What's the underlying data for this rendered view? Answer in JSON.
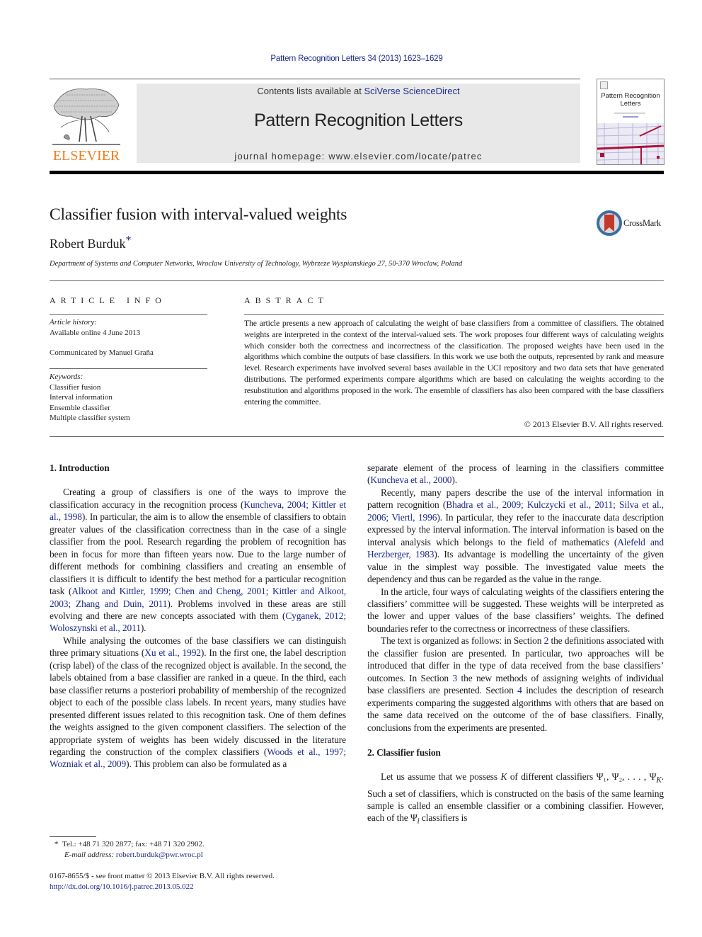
{
  "header": {
    "citation": "Pattern Recognition Letters 34 (2013) 1623–1629",
    "contents_prefix": "Contents lists available at ",
    "contents_link": "SciVerse ScienceDirect",
    "journal_title": "Pattern Recognition Letters",
    "homepage": "journal homepage: www.elsevier.com/locate/patrec",
    "publisher_logo_text": "ELSEVIER",
    "cover_title_line1": "Pattern Recognition",
    "cover_title_line2": "Letters",
    "colors": {
      "link": "#1b2a8a",
      "elsevier_orange": "#f07e1b",
      "banner_gray": "#e8e8e8",
      "crossmark_red": "#c0392b"
    }
  },
  "article": {
    "title": "Classifier fusion with interval-valued weights",
    "author": "Robert Burduk",
    "author_mark": "*",
    "affiliation": "Department of Systems and Computer Networks, Wroclaw University of Technology, Wybrzeze Wyspianskiego 27, 50-370 Wroclaw, Poland",
    "crossmark_label": "CrossMark"
  },
  "article_info": {
    "heading": "ARTICLE INFO",
    "history_label": "Article history:",
    "history_value": "Available online 4 June 2013",
    "communicated": "Communicated by Manuel Graña",
    "keywords_label": "Keywords:",
    "keywords": [
      "Classifier fusion",
      "Interval information",
      "Ensemble classifier",
      "Multiple classifier system"
    ]
  },
  "abstract": {
    "heading": "ABSTRACT",
    "text": "The article presents a new approach of calculating the weight of base classifiers from a committee of classifiers. The obtained weights are interpreted in the context of the interval-valued sets. The work proposes four different ways of calculating weights which consider both the correctness and incorrectness of the classification. The proposed weights have been used in the algorithms which combine the outputs of base classifiers. In this work we use both the outputs, represented by rank and measure level. Research experiments have involved several bases available in the UCI repository and two data sets that have generated distributions. The performed experiments compare algorithms which are based on calculating the weights according to the resubstitution and algorithms proposed in the work. The ensemble of classifiers has also been compared with the base classifiers entering the committee.",
    "copyright": "© 2013 Elsevier B.V. All rights reserved."
  },
  "body": {
    "sec1_heading": "1. Introduction",
    "p1": {
      "a": "Creating a group of classifiers is one of the ways to improve the classification accuracy in the recognition process (",
      "ref1": "Kuncheva, 2004; Kittler et al., 1998",
      "b": "). In particular, the aim is to allow the ensemble of classifiers to obtain greater values of the classification correctness than in the case of a single classifier from the pool. Research regarding the problem of recognition has been in focus for more than fifteen years now. Due to the large number of different methods for combining classifiers and creating an ensemble of classifiers it is difficult to identify the best method for a particular recognition task (",
      "ref2": "Alkoot and Kittler, 1999; Chen and Cheng, 2001; Kittler and Alkoot, 2003; Zhang and Duin, 2011",
      "c": "). Problems involved in these areas are still evolving and there are new concepts associated with them (",
      "ref3": "Cyganek, 2012; Woloszynski et al., 2011",
      "d": ")."
    },
    "p2": {
      "a": "While analysing the outcomes of the base classifiers we can distinguish three primary situations (",
      "ref1": "Xu et al., 1992",
      "b": "). In the first one, the label description (crisp label) of the class of the recognized object is available. In the second, the labels obtained from a base classifier are ranked in a queue. In the third, each base classifier returns a posteriori probability of membership of the recognized object to each of the possible class labels. In recent years, many studies have presented different issues related to this recognition task. One of them defines the weights assigned to the given component classifiers. The selection of the appropriate system of weights has been widely discussed in the literature regarding the construction of the complex classifiers (",
      "ref2": "Woods et al., 1997; Wozniak et al., 2009",
      "c": "). This problem can also be formulated as a separate element of the process of learning in the classifiers committee (",
      "ref3": "Kuncheva et al., 2000",
      "d": ")."
    },
    "p3": {
      "a": "Recently, many papers describe the use of the interval information in pattern recognition (",
      "ref1": "Bhadra et al., 2009; Kulczycki et al., 2011; Silva et al., 2006; Viertl, 1996",
      "b": "). In particular, they refer to the inaccurate data description expressed by the interval information. The interval information is based on the interval analysis which belongs to the field of mathematics (",
      "ref2": "Alefeld and Herzberger, 1983",
      "c": "). Its advantage is modelling the uncertainty of the given value in the simplest way possible. The investigated value meets the dependency and thus can be regarded as the value in the range."
    },
    "p4": "In the article, four ways of calculating weights of the classifiers entering the classifiers’ committee will be suggested. These weights will be interpreted as the lower and upper values of the base classifiers’ weights. The defined boundaries refer to the correctness or incorrectness of these classifiers.",
    "p5": {
      "a": "The text is organized as follows: in Section ",
      "s2": "2",
      "b": " the definitions associated with the classifier fusion are presented. In particular, two approaches will be introduced that differ in the type of data received from the base classifiers’ outcomes. In Section ",
      "s3": "3",
      "c": " the new methods of assigning weights of individual base classifiers are presented. Section ",
      "s4": "4",
      "d": " includes the description of research experiments comparing the suggested algorithms with others that are based on the same data received on the outcome of the of base classifiers. Finally, conclusions from the experiments are presented."
    },
    "sec2_heading": "2. Classifier fusion",
    "p6": {
      "a": "Let us assume that we possess ",
      "K": "K",
      "b": " of different classifiers ",
      "psi_list": "Ψ₁, Ψ₂, . . . , Ψ",
      "psi_sub": "K",
      "c": ". Such a set of classifiers, which is constructed on the basis of the same learning sample is called an ensemble classifier or a combining classifier. However, each of the ",
      "psi_i": "Ψ",
      "psi_i_sub": "i",
      "d": " classifiers is"
    }
  },
  "footnotes": {
    "mark": "*",
    "contact": "Tel.: +48 71 320 2877; fax: +48 71 320 2902.",
    "email_label": "E-mail address:",
    "email": "robert.burduk@pwr.wroc.pl",
    "front_matter": "0167-8655/$ - see front matter © 2013 Elsevier B.V. All rights reserved.",
    "doi": "http://dx.doi.org/10.1016/j.patrec.2013.05.022"
  }
}
